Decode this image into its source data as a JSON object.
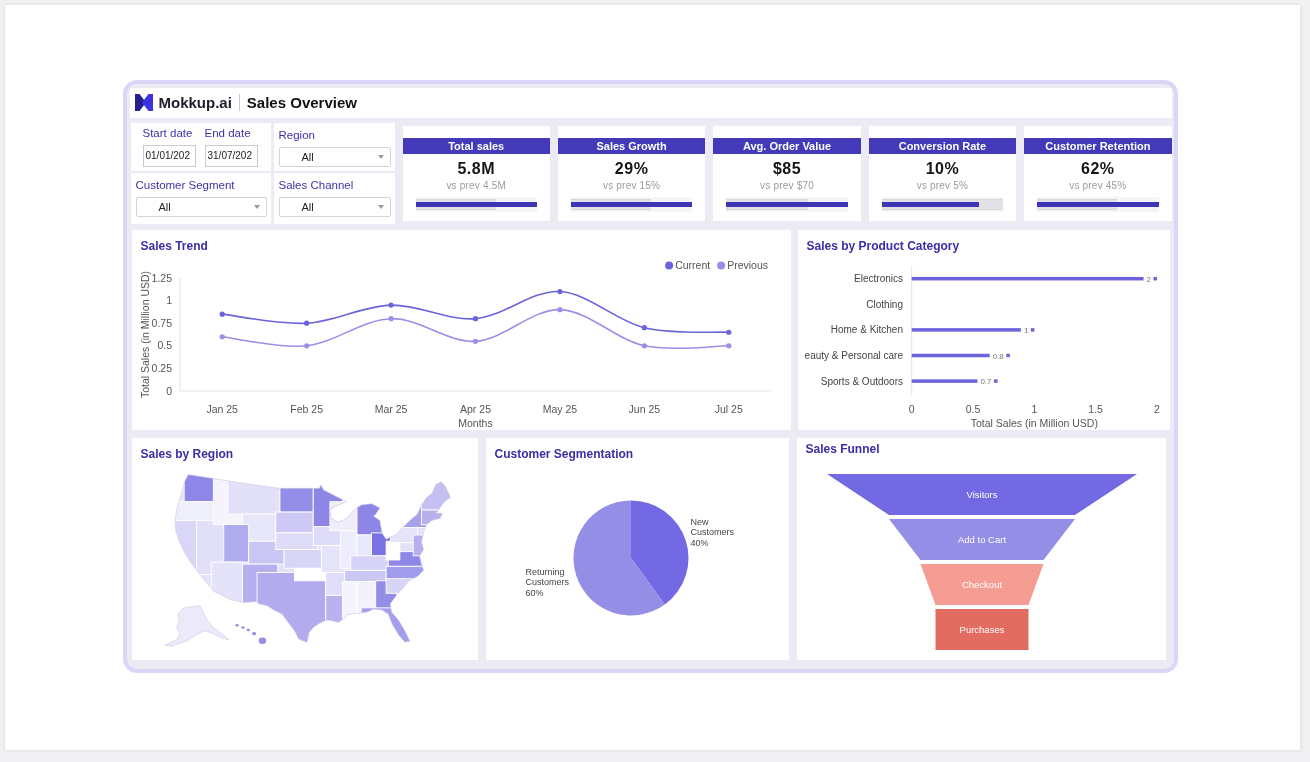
{
  "header": {
    "brand": "Mokkup.ai",
    "title": "Sales Overview"
  },
  "filters": [
    {
      "kind": "date_range",
      "fields": [
        {
          "label": "Start date",
          "value": "01/01/202"
        },
        {
          "label": "End date",
          "value": "31/07/202"
        }
      ]
    },
    {
      "kind": "select",
      "label": "Region",
      "value": "All"
    },
    {
      "kind": "select",
      "label": "Customer Segment",
      "value": "All"
    },
    {
      "kind": "select",
      "label": "Sales Channel",
      "value": "All"
    }
  ],
  "kpis": [
    {
      "title": "Total sales",
      "value": "5.8M",
      "comparison": "vs prev 4.5M",
      "current_bar": {
        "level": 1
      },
      "previous_bar": {
        "level": 0.66
      }
    },
    {
      "title": "Sales Growth",
      "value": "29%",
      "comparison": "vs prev 15%",
      "current_bar": {
        "level": 1
      },
      "previous_bar": {
        "level": 0.66
      }
    },
    {
      "title": "Avg. Order Value",
      "value": "$85",
      "comparison": "vs prev $70",
      "current_bar": {
        "level": 1
      },
      "previous_bar": {
        "level": 0.67
      }
    },
    {
      "title": "Conversion Rate",
      "value": "10%",
      "comparison": "vs prev 5%",
      "current_bar": {
        "level": 0.8
      },
      "previous_bar": {
        "level": 1
      }
    },
    {
      "title": "Customer Retention",
      "value": "62%",
      "comparison": "vs prev 45%",
      "current_bar": {
        "level": 1
      },
      "previous_bar": {
        "level": 0.66
      }
    }
  ],
  "sales_trend": {
    "title": "Sales Trend",
    "chart_data": {
      "type": "line",
      "xlabel": "Months",
      "ylabel": "Total Sales (in Million USD)",
      "categories": [
        "Jan 25",
        "Feb 25",
        "Mar 25",
        "Apr 25",
        "May 25",
        "Jun 25",
        "Jul 25"
      ],
      "series": [
        {
          "name": "Current",
          "color": "#6b62dd",
          "values": [
            0.85,
            0.75,
            0.95,
            0.8,
            1.1,
            0.7,
            0.65
          ]
        },
        {
          "name": "Previous",
          "color": "#9890e8",
          "values": [
            0.6,
            0.5,
            0.8,
            0.55,
            0.9,
            0.5,
            0.5
          ]
        }
      ],
      "ylim": [
        0,
        1.25
      ],
      "yticks": [
        0,
        0.25,
        0.5,
        0.75,
        1,
        1.25
      ],
      "legend": true
    }
  },
  "product_category": {
    "title": "Sales by Product Category",
    "chart_data": {
      "type": "bar",
      "orientation": "horizontal",
      "xlabel": "Total Sales (in Million USD)",
      "categories": [
        "Electronics",
        "Clothing",
        "Home & Kitchen",
        "eauty & Personal care",
        "Sports & Outdoors"
      ],
      "values": [
        2,
        null,
        1,
        0.8,
        0.7
      ],
      "xlim": [
        0,
        2
      ],
      "xticks": [
        0,
        0.5,
        1,
        1.5,
        2
      ],
      "data_labels": true
    }
  },
  "sales_by_region": {
    "title": "Sales by Region"
  },
  "customer_segmentation": {
    "title": "Customer Segmentation",
    "chart_data": {
      "type": "pie",
      "categories": [
        "New Customers",
        "Returning Customers"
      ],
      "values": [
        40,
        60
      ],
      "colors": [
        "#7469e4",
        "#958ee6"
      ],
      "value_labels": [
        "40%",
        "60%"
      ]
    }
  },
  "sales_funnel": {
    "title": "Sales Funnel",
    "stages": [
      {
        "label": "Visitors",
        "color": "#736ae3"
      },
      {
        "label": "Add to Cart",
        "color": "#958ee6"
      },
      {
        "label": "Checkout",
        "color": "#f59d92"
      },
      {
        "label": "Purchases",
        "color": "#e26c61"
      }
    ]
  }
}
